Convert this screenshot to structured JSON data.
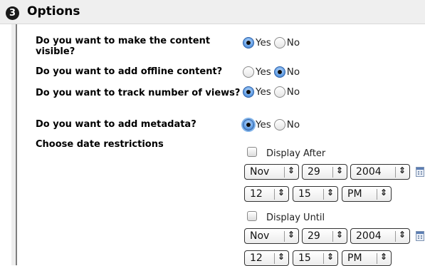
{
  "section": {
    "number": "3",
    "title": "Options"
  },
  "questions": [
    {
      "label": "Do you want to make the content visible?",
      "yes": "Yes",
      "no": "No",
      "selected": "Yes"
    },
    {
      "label": "Do you want to add offline content?",
      "yes": "Yes",
      "no": "No",
      "selected": "No"
    },
    {
      "label": "Do you want to track number of views?",
      "yes": "Yes",
      "no": "No",
      "selected": "Yes"
    },
    {
      "label": "Do you want to add metadata?",
      "yes": "Yes",
      "no": "No",
      "selected": "Yes"
    }
  ],
  "date_restrictions": {
    "label": "Choose date restrictions",
    "display_after": {
      "label": "Display After",
      "checked": false,
      "month": "Nov",
      "day": "29",
      "year": "2004",
      "hour": "12",
      "minute": "15",
      "ampm": "PM"
    },
    "display_until": {
      "label": "Display Until",
      "checked": false,
      "month": "Nov",
      "day": "29",
      "year": "2004",
      "hour": "12",
      "minute": "15",
      "ampm": "PM"
    }
  }
}
